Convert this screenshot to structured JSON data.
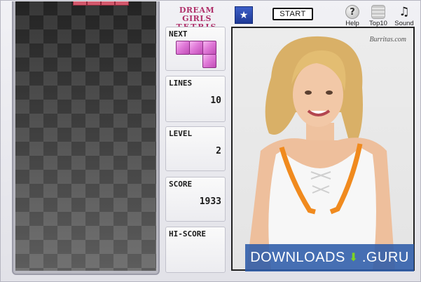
{
  "app": {
    "logo_line1": "DREAM GIRLS",
    "logo_line2": "TETRIS"
  },
  "toolbar": {
    "start_label": "START",
    "help_label": "Help",
    "top10_label": "Top10",
    "sound_label": "Sound",
    "help_icon": "?",
    "sound_icon": "♫"
  },
  "panels": {
    "next": {
      "title": "NEXT"
    },
    "lines": {
      "title": "LINES",
      "value": "10"
    },
    "level": {
      "title": "LEVEL",
      "value": "2"
    },
    "score": {
      "title": "SCORE",
      "value": "1933"
    },
    "hiscore": {
      "title": "HI-SCORE",
      "value": ""
    }
  },
  "photo": {
    "watermark": "Burritas.com"
  },
  "banner": {
    "left": "DOWNLOADS",
    "right": ".GURU"
  },
  "colors": {
    "piece": "#e07ad8",
    "active_piece": "#d45a6e",
    "logo": "#b0306a",
    "banner": "#2d5caa"
  }
}
